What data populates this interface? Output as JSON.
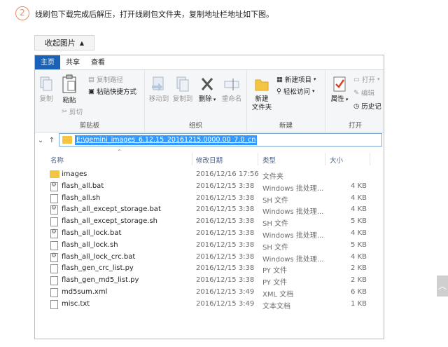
{
  "step": {
    "number": "2",
    "instruction": "线刷包下载完成后解压，打开线刷包文件夹，复制地址栏地址如下图。"
  },
  "collapse_button": {
    "label": "收起图片"
  },
  "explorer": {
    "tabs": [
      "主页",
      "共享",
      "查看"
    ],
    "ribbon": {
      "clipboard": {
        "label": "剪贴板",
        "copy": "复制",
        "paste": "粘贴",
        "copy_path": "复制路径",
        "paste_shortcut": "粘贴快捷方式",
        "cut": "剪切"
      },
      "organize": {
        "label": "组织",
        "move_to": "移动到",
        "copy_to": "复制到",
        "delete": "删除",
        "rename": "重命名"
      },
      "new": {
        "label": "新建",
        "new_folder": "新建\n文件夹",
        "new_item": "新建项目",
        "easy_access": "轻松访问"
      },
      "open": {
        "label": "打开",
        "properties": "属性",
        "open": "打开",
        "edit": "编辑",
        "history": "历史记"
      }
    },
    "address": "E:\\gemini_images_6.12.15_20161215.0000.00_7.0_cn",
    "columns": {
      "name": "名称",
      "date": "修改日期",
      "type": "类型",
      "size": "大小"
    },
    "files": [
      {
        "name": "images",
        "date": "2016/12/16 17:56",
        "type": "文件夹",
        "size": "",
        "icon": "folder"
      },
      {
        "name": "flash_all.bat",
        "date": "2016/12/15 3:38",
        "type": "Windows 批处理...",
        "size": "4 KB",
        "icon": "bat"
      },
      {
        "name": "flash_all.sh",
        "date": "2016/12/15 3:38",
        "type": "SH 文件",
        "size": "4 KB",
        "icon": "file"
      },
      {
        "name": "flash_all_except_storage.bat",
        "date": "2016/12/15 3:38",
        "type": "Windows 批处理...",
        "size": "4 KB",
        "icon": "bat"
      },
      {
        "name": "flash_all_except_storage.sh",
        "date": "2016/12/15 3:38",
        "type": "SH 文件",
        "size": "5 KB",
        "icon": "file"
      },
      {
        "name": "flash_all_lock.bat",
        "date": "2016/12/15 3:38",
        "type": "Windows 批处理...",
        "size": "4 KB",
        "icon": "bat"
      },
      {
        "name": "flash_all_lock.sh",
        "date": "2016/12/15 3:38",
        "type": "SH 文件",
        "size": "5 KB",
        "icon": "file"
      },
      {
        "name": "flash_all_lock_crc.bat",
        "date": "2016/12/15 3:38",
        "type": "Windows 批处理...",
        "size": "4 KB",
        "icon": "bat"
      },
      {
        "name": "flash_gen_crc_list.py",
        "date": "2016/12/15 3:38",
        "type": "PY 文件",
        "size": "2 KB",
        "icon": "file"
      },
      {
        "name": "flash_gen_md5_list.py",
        "date": "2016/12/15 3:38",
        "type": "PY 文件",
        "size": "2 KB",
        "icon": "file"
      },
      {
        "name": "md5sum.xml",
        "date": "2016/12/15 3:49",
        "type": "XML 文档",
        "size": "6 KB",
        "icon": "file"
      },
      {
        "name": "misc.txt",
        "date": "2016/12/15 3:49",
        "type": "文本文档",
        "size": "1 KB",
        "icon": "file"
      }
    ]
  }
}
